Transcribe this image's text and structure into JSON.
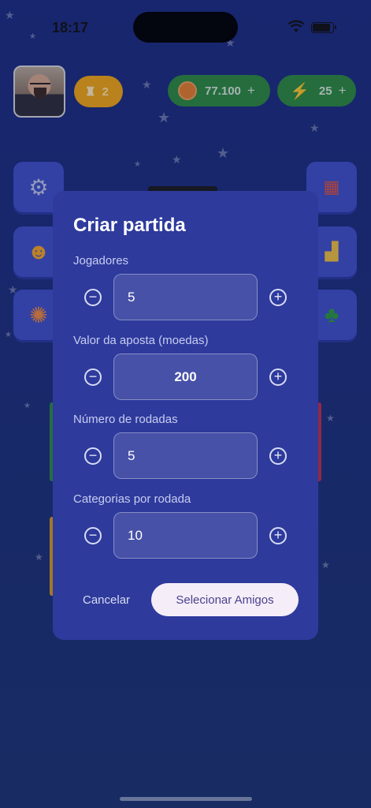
{
  "status": {
    "time": "18:17"
  },
  "header": {
    "trophies": "2",
    "coins": "77.100",
    "coins_plus": "+",
    "energy": "25",
    "energy_plus": "+"
  },
  "modal": {
    "title": "Criar partida",
    "fields": [
      {
        "label": "Jogadores",
        "value": "5"
      },
      {
        "label": "Valor da aposta (moedas)",
        "value": "200"
      },
      {
        "label": "Número de rodadas",
        "value": "5"
      },
      {
        "label": "Categorias por rodada",
        "value": "10"
      }
    ],
    "decrement_symbol": "−",
    "increment_symbol": "+",
    "cancel_label": "Cancelar",
    "confirm_label": "Selecionar Amigos"
  },
  "colors": {
    "background": "#1d2c80",
    "modal": "#2e3a9c",
    "trophy_pill": "#f3a712",
    "currency_pill": "#2e8b3e",
    "primary_button": "#f5eef8"
  },
  "icons": [
    "trophy-icon",
    "coin-icon",
    "bolt-icon",
    "gear-icon",
    "shop-icon",
    "emoji-icon",
    "podium-icon",
    "wheel-icon",
    "clover-icon"
  ]
}
